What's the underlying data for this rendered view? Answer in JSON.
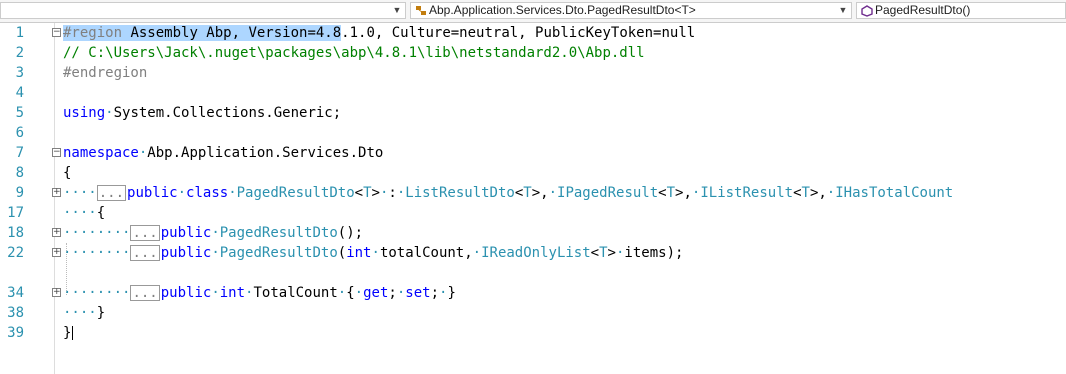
{
  "nav": {
    "project_dropdown": "",
    "type_dropdown": "Abp.Application.Services.Dto.PagedResultDto<T>",
    "member_dropdown": "PagedResultDto()"
  },
  "editor": {
    "lines": [
      {
        "num": "1"
      },
      {
        "num": "2"
      },
      {
        "num": "3"
      },
      {
        "num": "4"
      },
      {
        "num": "5"
      },
      {
        "num": "6"
      },
      {
        "num": "7"
      },
      {
        "num": "8"
      },
      {
        "num": "9"
      },
      {
        "num": "17"
      },
      {
        "num": "18"
      },
      {
        "num": "22"
      },
      {
        "num": "34"
      },
      {
        "num": "38"
      },
      {
        "num": "39"
      }
    ],
    "text": {
      "region_kw": "#region",
      "region_sel": " Assembly Abp, Version=4.8",
      "region_rest": ".1.0, Culture=neutral, PublicKeyToken=null",
      "comment_path": "// C:\\Users\\Jack\\.nuget\\packages\\abp\\4.8.1\\lib\\netstandard2.0\\Abp.dll",
      "endregion": "#endregion",
      "using_kw": "using",
      "using_ns": "System.Collections.Generic;",
      "namespace_kw": "namespace",
      "namespace_name": "Abp.Application.Services.Dto",
      "open_brace": "{",
      "close_brace": "}",
      "collapsed": "...",
      "public_kw": "public",
      "class_kw": "class",
      "int_kw": "int",
      "get_kw": "get",
      "set_kw": "set",
      "class_name": "PagedResultDto",
      "t_param": "T",
      "list_result": "ListResultDto",
      "i_paged": "IPagedResult",
      "i_list": "IListResult",
      "i_total": "IHasTotalCount",
      "ctor_name": "PagedResultDto",
      "ctor1_tail": "();",
      "param_total": "totalCount,",
      "read_only": "IReadOnlyList",
      "param_items": "items);",
      "prop_name": "TotalCount",
      "prop_open": "{",
      "prop_close": "}",
      "semi": ";"
    }
  }
}
